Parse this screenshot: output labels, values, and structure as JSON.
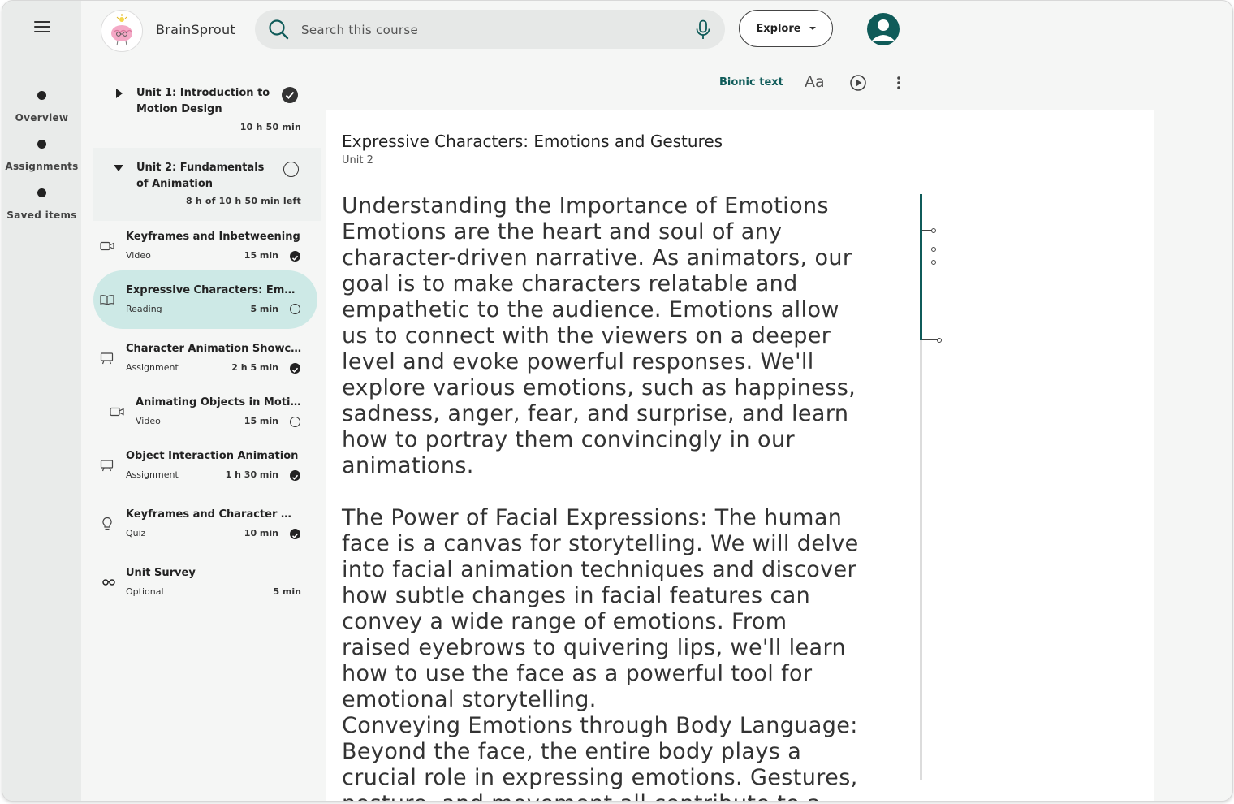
{
  "app": {
    "brand": "BrainSprout"
  },
  "rail": {
    "items": [
      {
        "label": "Overview"
      },
      {
        "label": "Assignments"
      },
      {
        "label": "Saved items"
      }
    ]
  },
  "search": {
    "placeholder": "Search this course"
  },
  "explore": {
    "label": "Explore"
  },
  "toolbar": {
    "bionic": "Bionic text",
    "font_size": "Aa"
  },
  "units": [
    {
      "title": "Unit 1: Introduction to Motion Design",
      "meta": "10 h 50 min",
      "expanded": false,
      "complete": true
    },
    {
      "title": "Unit 2: Fundamentals of Animation",
      "meta": "8 h of 10 h 50 min left",
      "expanded": true,
      "complete": false
    }
  ],
  "items": [
    {
      "title": "Keyframes and Inbetweening",
      "type": "Video",
      "time": "15 min",
      "icon": "video-icon",
      "complete": true
    },
    {
      "title": "Expressive Characters: Emotions and Gestures",
      "type": "Reading",
      "time": "5 min",
      "icon": "book-icon",
      "complete": false,
      "selected": true
    },
    {
      "title": "Character Animation Showcase",
      "type": "Assignment",
      "time": "2 h 5 min",
      "icon": "presentation-icon",
      "complete": true
    },
    {
      "title": "Animating Objects in Motion Graphics",
      "type": "Video",
      "time": "15 min",
      "icon": "video-icon",
      "complete": false
    },
    {
      "title": "Object Interaction Animation",
      "type": "Assignment",
      "time": "1 h 30 min",
      "icon": "presentation-icon",
      "complete": true
    },
    {
      "title": "Keyframes and Character Animation",
      "type": "Quiz",
      "time": "10 min",
      "icon": "lightbulb-icon",
      "complete": true
    },
    {
      "title": "Unit Survey",
      "type": "Optional",
      "time": "5 min",
      "icon": "glasses-icon",
      "complete": null
    }
  ],
  "doc": {
    "title": "Expressive Characters: Emotions and Gestures",
    "subtitle": "Unit 2",
    "paragraphs": [
      "Understanding the Importance of Emotions Emotions are the heart and soul of any character-driven narrative. As animators, our goal is to make characters relatable and empathetic to the audience. Emotions allow us to connect with the viewers on a deeper level and evoke powerful responses. We'll explore various emotions, such as happiness, sadness, anger, fear, and surprise, and learn how to portray them convincingly in our animations.",
      "The Power of Facial Expressions: The human face is a canvas for storytelling. We will delve into facial animation techniques and discover how subtle changes in facial features can convey a wide range of emotions. From raised eyebrows to quivering lips, we'll learn how to use the face as a powerful tool for emotional storytelling.",
      "Conveying Emotions through Body Language: Beyond the face, the entire body plays a crucial role in expressing emotions. Gestures, posture, and movement all contribute to a character's emotional state."
    ]
  },
  "colors": {
    "accent": "#0f5b59",
    "selected_bg": "#cde9e6",
    "unit_bg": "#eef1f0"
  }
}
